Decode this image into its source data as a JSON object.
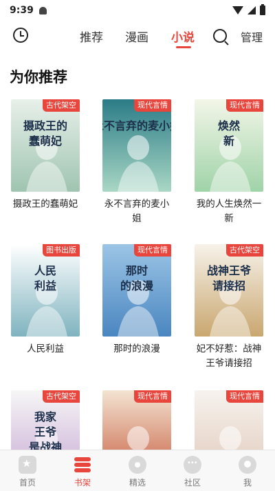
{
  "status_bar": {
    "time": "9:39"
  },
  "top_nav": {
    "tabs": [
      {
        "label": "推荐"
      },
      {
        "label": "漫画"
      },
      {
        "label": "小说"
      }
    ],
    "active_tab": "小说",
    "manage_label": "管理",
    "accent_color": "#e8453c"
  },
  "section": {
    "title": "为你推荐"
  },
  "books": [
    {
      "title": "摄政王的蠢萌妃",
      "tag": "古代架空",
      "cover_text": "摄政王的 蠢萌妃",
      "cover_colors": [
        "#e8f0ea",
        "#9fc4b0"
      ]
    },
    {
      "title": "永不言弃的麦小姐",
      "tag": "现代言情",
      "cover_text": "永不言弃的麦小姐",
      "cover_colors": [
        "#2b7c87",
        "#a9d7c4"
      ]
    },
    {
      "title": "我的人生焕然一新",
      "tag": "现代言情",
      "cover_text": "焕然 新",
      "cover_colors": [
        "#f3f6e8",
        "#9fd3a8"
      ]
    },
    {
      "title": "人民利益",
      "tag": "图书出版",
      "cover_text": "人民 利益",
      "cover_colors": [
        "#ffffff",
        "#7fb3bf"
      ]
    },
    {
      "title": "那时的浪漫",
      "tag": "现代言情",
      "cover_text": "那时 的浪漫",
      "cover_colors": [
        "#9cc5e6",
        "#4a86c0"
      ]
    },
    {
      "title": "妃不好惹：战神王爷请接招",
      "tag": "古代架空",
      "cover_text": "战神王爷 请接招",
      "cover_colors": [
        "#f7f2ea",
        "#c9a76f"
      ]
    },
    {
      "title": "",
      "tag": "古代架空",
      "cover_text": "我家 王爷 是战神",
      "cover_colors": [
        "#f6f6f6",
        "#c7a8d4"
      ]
    },
    {
      "title": "",
      "tag": "现代言情",
      "cover_text": "",
      "cover_colors": [
        "#f3e4d2",
        "#c65a3c"
      ]
    },
    {
      "title": "",
      "tag": "现代言情",
      "cover_text": "",
      "cover_colors": [
        "#f6f3ef",
        "#e0c7b7"
      ]
    }
  ],
  "bottom_nav": {
    "items": [
      {
        "label": "首页"
      },
      {
        "label": "书架"
      },
      {
        "label": "精选"
      },
      {
        "label": "社区"
      },
      {
        "label": "我"
      }
    ],
    "active": "书架"
  }
}
